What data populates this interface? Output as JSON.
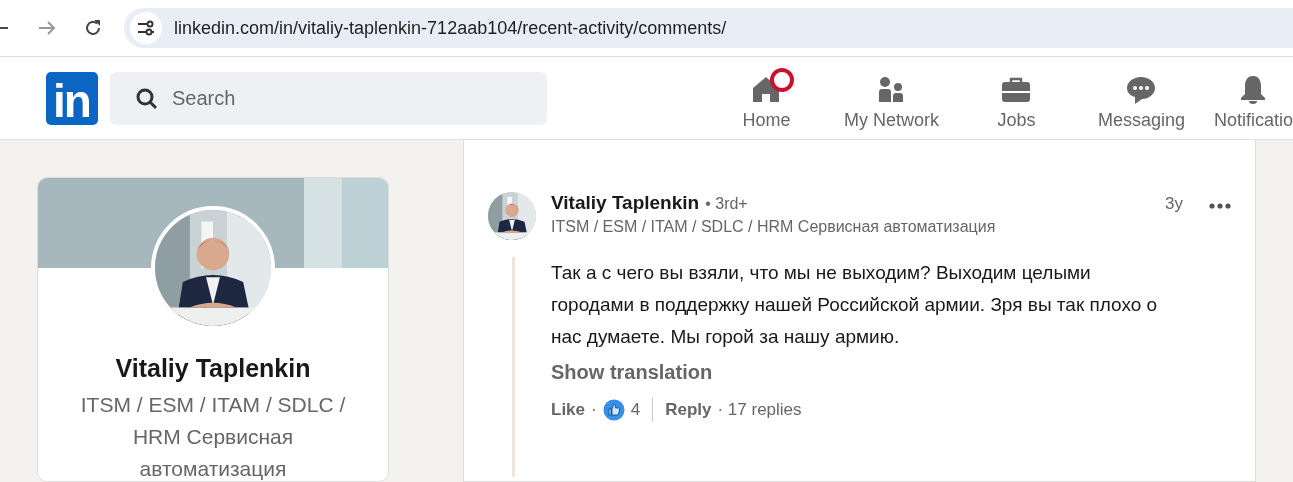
{
  "browser": {
    "url": "linkedin.com/in/vitaliy-taplenkin-712aab104/recent-activity/comments/"
  },
  "header": {
    "logo": "in",
    "search": {
      "placeholder": "Search"
    },
    "nav": [
      {
        "label": "Home",
        "kind": "home",
        "notification": true
      },
      {
        "label": "My Network",
        "kind": "network",
        "notification": false
      },
      {
        "label": "Jobs",
        "kind": "jobs",
        "notification": false
      },
      {
        "label": "Messaging",
        "kind": "messaging",
        "notification": false
      },
      {
        "label": "Notificatio",
        "kind": "notifications",
        "notification": false
      }
    ]
  },
  "profile": {
    "name": "Vitaliy Taplenkin",
    "headline": "ITSM / ESM / ITAM / SDLC / HRM Сервисная автоматизация"
  },
  "comment": {
    "author": "Vitaliy Taplenkin",
    "degree": "• 3rd+",
    "headline": "ITSM / ESM / ITAM / SDLC / HRM Сервисная автоматизация",
    "time": "3y",
    "text": "Так а с чего вы взяли, что мы не выходим? Выходим целыми городами в поддержку нашей Российской армии. Зря вы так плохо о нас думаете. Мы горой за нашу армию.",
    "translate": "Show translation",
    "like": "Like",
    "like_separator": "·",
    "reaction_count": "4",
    "reply": "Reply",
    "replies": "· 17 replies"
  }
}
